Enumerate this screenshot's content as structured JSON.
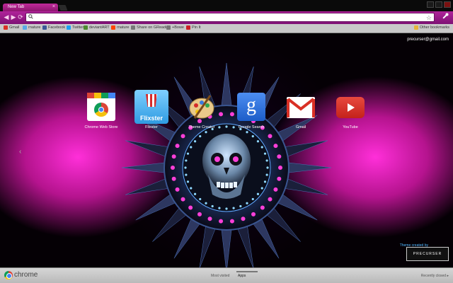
{
  "tab": {
    "title": "New Tab",
    "close": "×"
  },
  "toolbar": {
    "back": "◀",
    "forward": "▶",
    "reload": "⟳",
    "search_glyph": "🔍",
    "star": "☆",
    "wrench": "🔧"
  },
  "bookmarks": [
    {
      "label": "Gmail",
      "icon": "gmail-icon",
      "color": "#d93025"
    },
    {
      "label": "rnature",
      "icon": "cloud-icon",
      "color": "#5aa9e6"
    },
    {
      "label": "Facebook",
      "icon": "facebook-icon",
      "color": "#3b5998"
    },
    {
      "label": "Twitter",
      "icon": "twitter-icon",
      "color": "#1da1f2"
    },
    {
      "label": "deviantART",
      "icon": "deviantart-icon",
      "color": "#4c8a2f"
    },
    {
      "label": "rnature",
      "icon": "reddit-icon",
      "color": "#ff4500"
    },
    {
      "label": "Share on GReader",
      "icon": "greader-icon",
      "color": "#777777"
    },
    {
      "label": "+Bowe",
      "icon": "plus-icon",
      "color": "#777777"
    },
    {
      "label": "Pin It",
      "icon": "pin-icon",
      "color": "#cb2027"
    }
  ],
  "other_bookmarks": "Other bookmarks",
  "user_email": "precurser@gmail.com",
  "apps": [
    {
      "label": "Chrome Web Store",
      "icon": "chrome-web-store-icon"
    },
    {
      "label": "Flixster",
      "icon": "flixster-icon",
      "icon_text": "Flixster"
    },
    {
      "label": "Theme Creator",
      "icon": "palette-icon"
    },
    {
      "label": "Google Search",
      "icon": "google-search-icon",
      "icon_text": "g"
    },
    {
      "label": "Gmail",
      "icon": "gmail-icon"
    },
    {
      "label": "YouTube",
      "icon": "youtube-icon"
    }
  ],
  "credit": {
    "label": "Theme created by",
    "logo_text": "PRECURSER"
  },
  "footer": {
    "logo_text": "chrome",
    "tabs": [
      {
        "label": "Most visited"
      },
      {
        "label": "Apps"
      }
    ],
    "recently_closed": "Recently closed ▸"
  },
  "colors": {
    "accent": "#b0249a",
    "glow": "#ff2fd9"
  }
}
